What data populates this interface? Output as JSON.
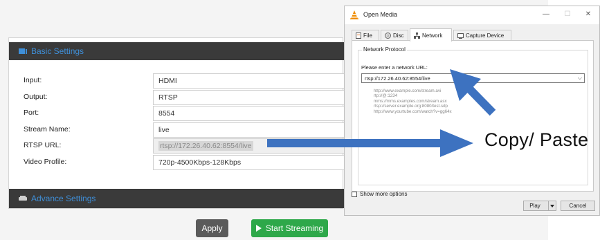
{
  "settings": {
    "basic_title": "Basic Settings",
    "advanced_title": "Advance Settings",
    "rows": [
      {
        "label": "Input:",
        "value": "HDMI"
      },
      {
        "label": "Output:",
        "value": "RTSP"
      },
      {
        "label": "Port:",
        "value": "8554"
      },
      {
        "label": "Stream Name:",
        "value": "live"
      },
      {
        "label": "RTSP URL:",
        "value": "rtsp://172.26.40.62:8554/live"
      },
      {
        "label": "Video Profile:",
        "value": "720p-4500Kbps-128Kbps"
      }
    ],
    "apply_label": "Apply",
    "start_label": "Start Streaming"
  },
  "dialog": {
    "title": "Open Media",
    "tabs": [
      {
        "label": "File",
        "icon": "file-icon"
      },
      {
        "label": "Disc",
        "icon": "disc-icon"
      },
      {
        "label": "Network",
        "icon": "network-icon",
        "active": true
      },
      {
        "label": "Capture Device",
        "icon": "capture-device-icon"
      }
    ],
    "group_title": "Network Protocol",
    "url_prompt": "Please enter a network URL:",
    "url_value": "rtsp://172.26.40.62:8554/live",
    "examples": [
      "http://www.example.com/stream.avi",
      "rtp://@:1234",
      "mms://mms.examples.com/stream.asx",
      "rtsp://server.example.org:8080/test.sdp",
      "http://www.yourtube.com/watch?v=gg64x"
    ],
    "show_more_label": "Show more options",
    "play_label": "Play",
    "cancel_label": "Cancel",
    "controls": {
      "minimize": "—",
      "maximize": "☐",
      "close": "✕"
    }
  },
  "annotation": {
    "text": "Copy/ Paste",
    "arrow_color": "#3d72c0"
  },
  "colors": {
    "header_bg": "#3a3a3a",
    "header_text": "#3f8fd8",
    "start_button": "#2ea84a",
    "apply_button": "#5a5a5a",
    "vlc_orange": "#f08c00"
  }
}
